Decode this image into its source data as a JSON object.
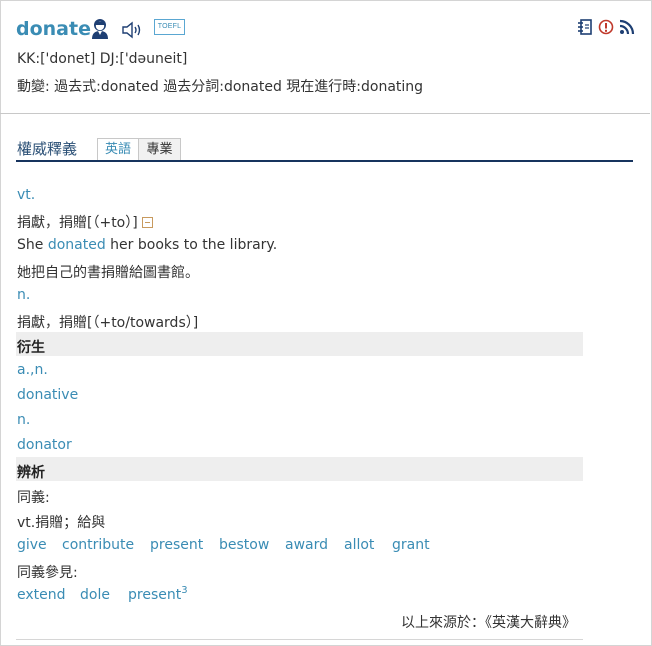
{
  "header": {
    "word": "donate",
    "badge": "TOEFL",
    "phonetics": "KK:['donet] DJ:['dəuneit]",
    "forms": "動變: 過去式:donated  過去分詞:donated  現在進行時:donating",
    "icons": [
      "person-icon",
      "speaker-icon",
      "notebook-icon",
      "report-icon",
      "rss-icon"
    ]
  },
  "section": {
    "title": "權威釋義",
    "tabs": [
      {
        "label": "英語",
        "active": true
      },
      {
        "label": "專業",
        "active": false
      }
    ]
  },
  "entries": {
    "pos1": "vt.",
    "def1": "捐獻，捐贈[（+to）]",
    "example_before": "She ",
    "example_word": "donated",
    "example_after": " her books to the library.",
    "translation": "她把自己的書捐贈給圖書館。",
    "pos2": "n.",
    "def2": "捐獻，捐贈[（+to/towards）]"
  },
  "derived": {
    "title": "衍生",
    "lines": [
      "a.,n.",
      "donative",
      "n.",
      "donator"
    ]
  },
  "analysis": {
    "title": "辨析",
    "synonym_label": "同義:",
    "synonym_def": "vt.捐贈；給與",
    "synonyms": [
      "give",
      "contribute",
      "present",
      "bestow",
      "award",
      "allot",
      "grant"
    ],
    "see_also_label": "同義參見:",
    "see_also": [
      "extend",
      "dole",
      "present"
    ],
    "see_also_sup": "3"
  },
  "source": "以上來源於：《英漢大辭典》",
  "colors": {
    "accent": "#3a8cb4",
    "rule": "#17345e",
    "band": "#eeeeee"
  }
}
